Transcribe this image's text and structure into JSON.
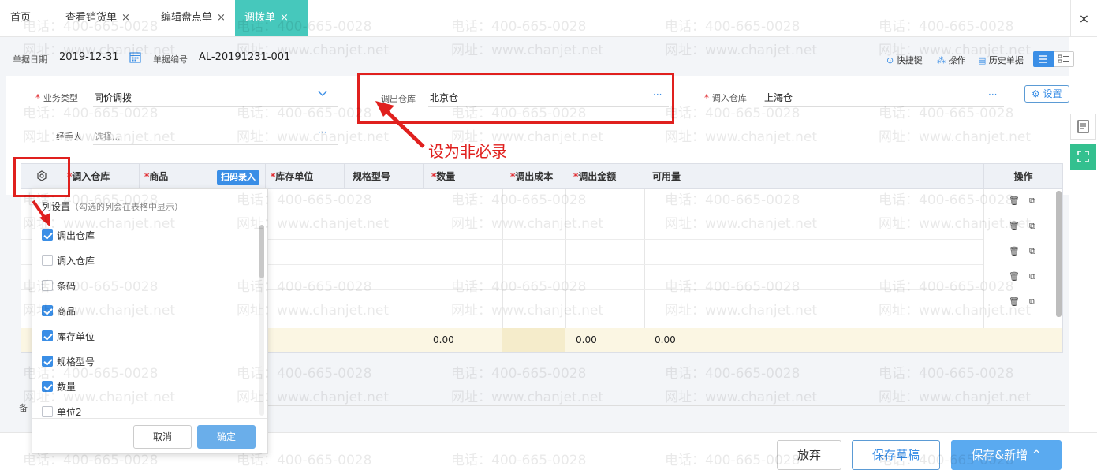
{
  "tabs": [
    {
      "label": "首页"
    },
    {
      "label": "查看销货单",
      "close": "×"
    },
    {
      "label": "编辑盘点单",
      "close": "×"
    },
    {
      "label": "调拨单",
      "close": "×"
    }
  ],
  "window_close": "×",
  "docbar": {
    "date_label": "单据日期",
    "date_value": "2019-12-31",
    "number_label": "单据编号",
    "number_value": "AL-20191231-001",
    "shortcut": "快捷键",
    "operate": "操作",
    "history": "历史单据"
  },
  "form": {
    "biz_type_label": "业务类型",
    "biz_type_value": "同价调拨",
    "out_wh_label": "调出仓库",
    "out_wh_value": "北京仓",
    "in_wh_label": "调入仓库",
    "in_wh_value": "上海仓",
    "handler_label": "经手人",
    "handler_placeholder": "选择...",
    "settings_button": "设置",
    "more": "···",
    "required_mark": "*"
  },
  "grid": {
    "headers": [
      "调入仓库",
      "商品",
      "库存单位",
      "规格型号",
      "数量",
      "调出成本",
      "调出金额",
      "可用量",
      "操作"
    ],
    "scan_button": "扫码录入",
    "summary": {
      "quantity": "0.00",
      "amount": "0.00",
      "available": "0.00"
    }
  },
  "column_popup": {
    "title": "列设置",
    "hint": "（勾选的列会在表格中显示）",
    "items": [
      {
        "label": "调出仓库",
        "checked": true
      },
      {
        "label": "调入仓库",
        "checked": false
      },
      {
        "label": "条码",
        "checked": false
      },
      {
        "label": "商品",
        "checked": true
      },
      {
        "label": "库存单位",
        "checked": true
      },
      {
        "label": "规格型号",
        "checked": true
      },
      {
        "label": "数量",
        "checked": true
      },
      {
        "label": "单位2",
        "checked": false
      }
    ],
    "cancel": "取消",
    "confirm": "确定"
  },
  "remark_label": "备",
  "actions": {
    "give_up": "放弃",
    "save_draft": "保存草稿",
    "save_new": "保存&新增",
    "save_new_caret": "^"
  },
  "annotation": {
    "text": "设为非必录"
  },
  "watermark": {
    "phone": "电话：400-665-0028",
    "site": "网址：www.chanjet.net"
  },
  "colors": {
    "accent": "#46c8bc",
    "primary": "#3a8ee6",
    "annotation_red": "#e0201e",
    "summary_bg": "#fbf6e3"
  }
}
